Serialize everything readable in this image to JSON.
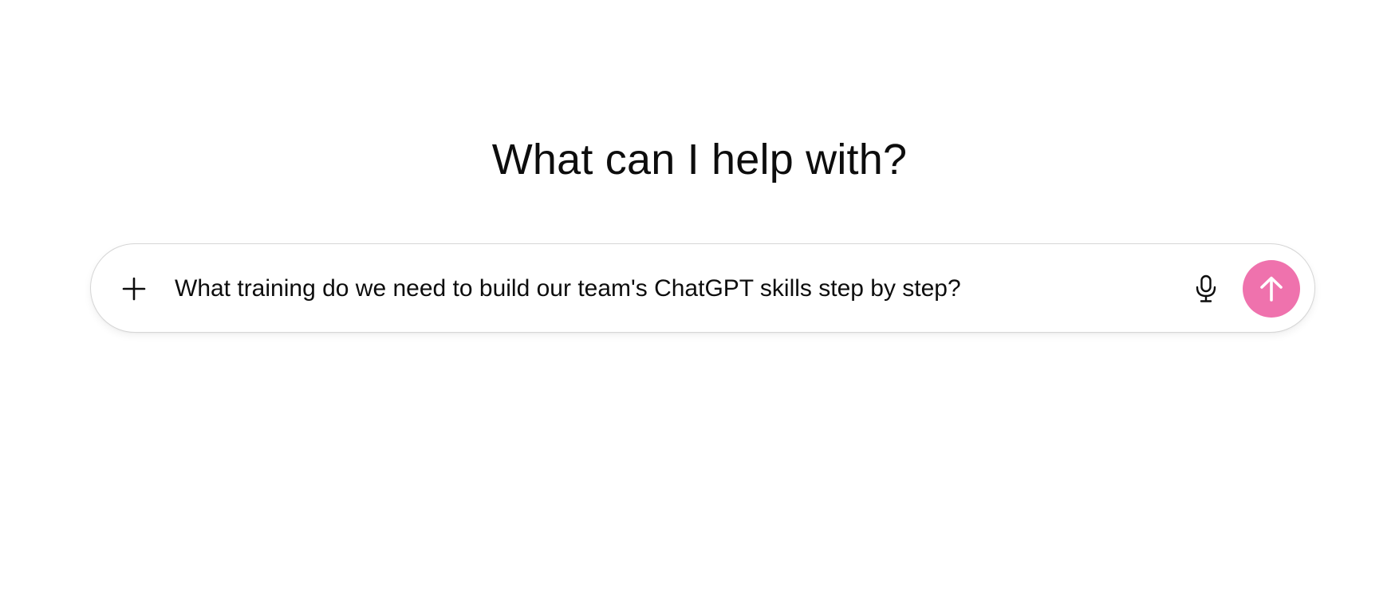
{
  "heading": "What can I help with?",
  "composer": {
    "input_value": "What training do we need to build our team's ChatGPT skills step by step?",
    "attach_icon": "plus-icon",
    "voice_icon": "microphone-icon",
    "send_icon": "arrow-up-icon",
    "send_color": "#ef72ad"
  }
}
